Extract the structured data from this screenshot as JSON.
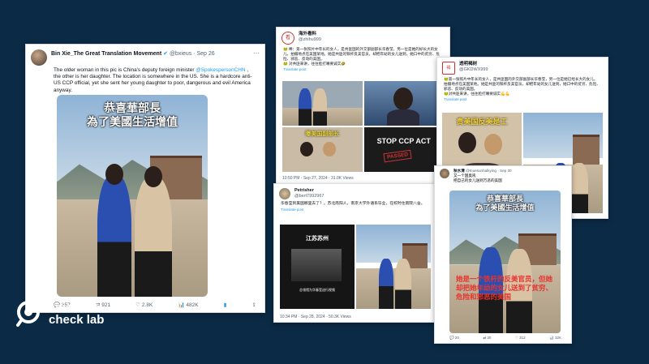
{
  "card1": {
    "name": "Bin Xie_The Great Translation Movement",
    "handle": "@bxieus · Sep 26",
    "text_before": "The older woman in this pic is China's deputy foreign minister ",
    "mention": "@SpokespersonCHN",
    "text_after": " , the other is her daughter. The location is somewhere in the US. She is a hardcore anti-US CCP official, yet she sent her young daughter to poor, dangerous and evil America anyway.",
    "caption_line1": "恭喜華部長",
    "caption_line2": "為了美國生活增值",
    "actions": {
      "reply": "357",
      "retweet": "921",
      "like": "2.8K",
      "views": "482K"
    }
  },
  "card2": {
    "name": "海外看料",
    "handle": "@zhihu999",
    "text": "🐸 棒：第一张照片中年长的女人，是共匪国的外交部副部长华春莹，另一位是她的好长大的女儿。拍摄地点在美国某地。她是共匪的铁杆反美官员，却把年幼的女儿送到，她口中的贫穷、危险、邪恶、反动的美国。\n🐸 对共匪来讲，往往脸打嘴要诚实🤣",
    "translate": "Translate post",
    "img_caption": "曝美国副部长",
    "stop_text": "STOP CCP ACT",
    "passed": "PASSED",
    "timestamp": "10:50 PM · Sep 27, 2024 · 31.0K Views"
  },
  "card3": {
    "name": "透明褐树",
    "handle": "@GKDWX999",
    "text": "🐸第一张照片中年长的女人，是共匪国的外交部副部长华春莹，另一位是她已经长大的女儿。拍摄地点在美国某地。她是共匪的铁杆反美官员，却把年幼的女儿送到，她口中的贫穷、危险、邪恶、反动的美国。\n🐸对共匪来讲，往往脸打嘴要诚实💪💪",
    "translate": "Translate post",
    "img_banner": "贵美国反美是工"
  },
  "card4": {
    "name": "Petrisher",
    "handle": "@bert7992967",
    "text": "华春莹到美国哪里去了？。苏北南阳人，南京大学外语系毕业，在校时住南院八舍。",
    "translate": "Translate post",
    "video_caption": "江苏苏州",
    "video_sub": "总领馆为华春莹送行视频",
    "timestamp": "10:34 PM · Sep 28, 2024 · 50.3K Views"
  },
  "card5": {
    "name": "秋水清",
    "handle": "@Inuesunhalkying · Sep 30",
    "line1": "又一个国奥吼",
    "line2": "把自己的女儿送到万恶的美国",
    "caption_line1": "恭喜華部長",
    "caption_line2": "為了美國生活增值",
    "red_text": "她是一个铁杆的反美官员，但她却把她年幼的女儿送到了贫穷、危险和邪恶的美国",
    "actions": {
      "reply": "20",
      "retweet": "30",
      "like": "312",
      "views": "32K"
    }
  },
  "logo": {
    "line1": "asia fact",
    "line2": "check lab"
  },
  "colors": {
    "background": "#0b2a45",
    "link": "#1d9bf0",
    "bookmark": "#1d9bf0"
  }
}
